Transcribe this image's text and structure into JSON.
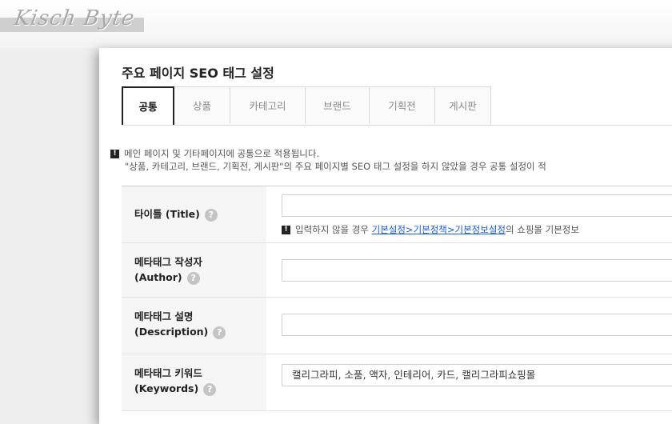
{
  "watermark": "Kisch Byte",
  "page_title": "주요 페이지 SEO 태그 설정",
  "tabs": [
    {
      "label": "공통",
      "active": true
    },
    {
      "label": "상품",
      "active": false
    },
    {
      "label": "카테고리",
      "active": false
    },
    {
      "label": "브랜드",
      "active": false
    },
    {
      "label": "기획전",
      "active": false
    },
    {
      "label": "게시판",
      "active": false
    }
  ],
  "notice": {
    "icon": "exclamation-icon",
    "line1": "메인 페이지 및 기타페이지에 공통으로 적용됩니다.",
    "line2": "\"상품, 카테고리, 브랜드, 기획전, 게시판\"의 주요 페이지별 SEO 태그 설정을 하지 않았을 경우 공통 설정이 적"
  },
  "form": {
    "title": {
      "label": "타이틀 (Title)",
      "value": "",
      "hint_prefix": "입력하지 않을 경우 ",
      "hint_link": "기본설정>기본정책>기본정보설정",
      "hint_suffix": "의 쇼핑몰 기본정보"
    },
    "author": {
      "label_line1": "메타태그 작성자",
      "label_line2": "(Author)",
      "value": ""
    },
    "description": {
      "label_line1": "메타태그 설명",
      "label_line2": "(Description)",
      "value": ""
    },
    "keywords": {
      "label_line1": "메타태그 키워드",
      "label_line2": "(Keywords)",
      "value": "캘리그라피, 소품, 액자, 인테리어, 카드, 캘리그라피쇼핑몰"
    }
  },
  "help_glyph": "?",
  "excl_glyph": "!"
}
